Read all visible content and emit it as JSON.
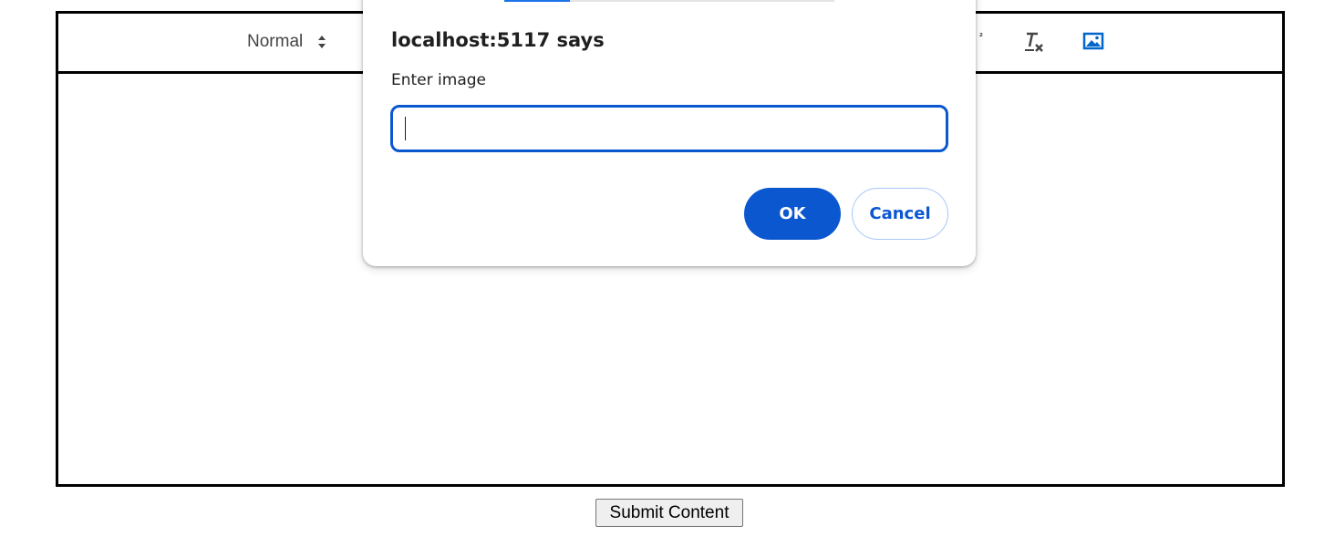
{
  "toolbar": {
    "header_select_value": "Normal",
    "superscript_fragment": "²",
    "icons": [
      "chevron-updown-icon",
      "clear-format-icon",
      "image-icon"
    ]
  },
  "dialog": {
    "title": "localhost:5117 says",
    "message": "Enter image",
    "input_value": "",
    "ok_label": "OK",
    "cancel_label": "Cancel"
  },
  "form": {
    "submit_label": "Submit Content"
  },
  "colors": {
    "dialog_accent": "#0b57d0",
    "image_icon": "#0066cc",
    "toolbar_icon": "#444444"
  }
}
